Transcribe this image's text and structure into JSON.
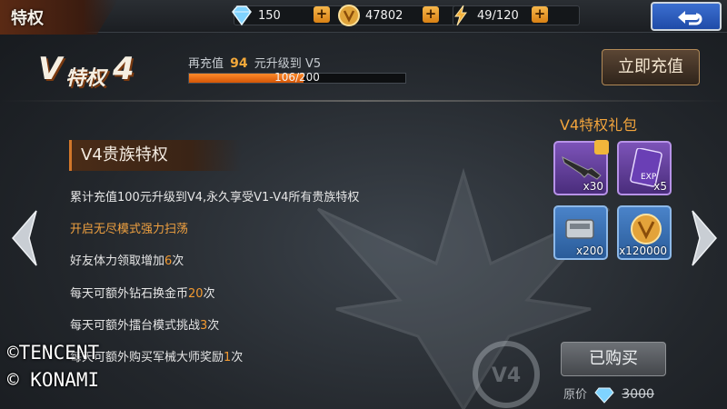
{
  "header": {
    "title": "特权",
    "resources": [
      {
        "icon": "diamond-icon",
        "value": "150"
      },
      {
        "icon": "gold-coin-icon",
        "value": "47802"
      },
      {
        "icon": "stamina-icon",
        "value": "49/120"
      }
    ]
  },
  "vip": {
    "logo_v": "V",
    "logo_text": "特权",
    "level": "4",
    "upgrade_prefix": "再充值",
    "upgrade_amount": "94",
    "upgrade_suffix": "元升级到",
    "next_level": "V5",
    "progress_text": "106/200",
    "progress_fraction": 0.53,
    "recharge_label": "立即充值"
  },
  "privilege": {
    "title": "V4贵族特权",
    "summary": "累计充值100元升级到V4,永久享受V1-V4所有贵族特权",
    "unlock": "开启无尽模式强力扫荡",
    "perks": [
      {
        "prefix": "好友体力领取增加",
        "num": "6",
        "suffix": "次"
      },
      {
        "prefix": "每天可额外钻石换金币",
        "num": "20",
        "suffix": "次"
      },
      {
        "prefix": "每天可额外擂台模式挑战",
        "num": "3",
        "suffix": "次"
      },
      {
        "prefix": "每天可额外购买军械大师奖励",
        "num": "1",
        "suffix": "次"
      }
    ]
  },
  "gift": {
    "title": "V4特权礼包",
    "items": [
      {
        "icon": "rifle-icon",
        "count": "x30",
        "rarity": "purple"
      },
      {
        "icon": "exp-card-icon",
        "count": "x5",
        "rarity": "purple"
      },
      {
        "icon": "ammo-box-icon",
        "count": "x200",
        "rarity": "blue"
      },
      {
        "icon": "gold-medal-icon",
        "count": "x120000",
        "rarity": "blue"
      }
    ],
    "bought_label": "已购买",
    "orig_price_label": "原价",
    "orig_price": "3000",
    "badge_text": "V4"
  },
  "copyright": [
    "©TENCENT",
    "© KONAMI"
  ],
  "colors": {
    "accent": "#f2a43c",
    "progress": "#e8670f",
    "back_button": "#2d5fc0"
  }
}
